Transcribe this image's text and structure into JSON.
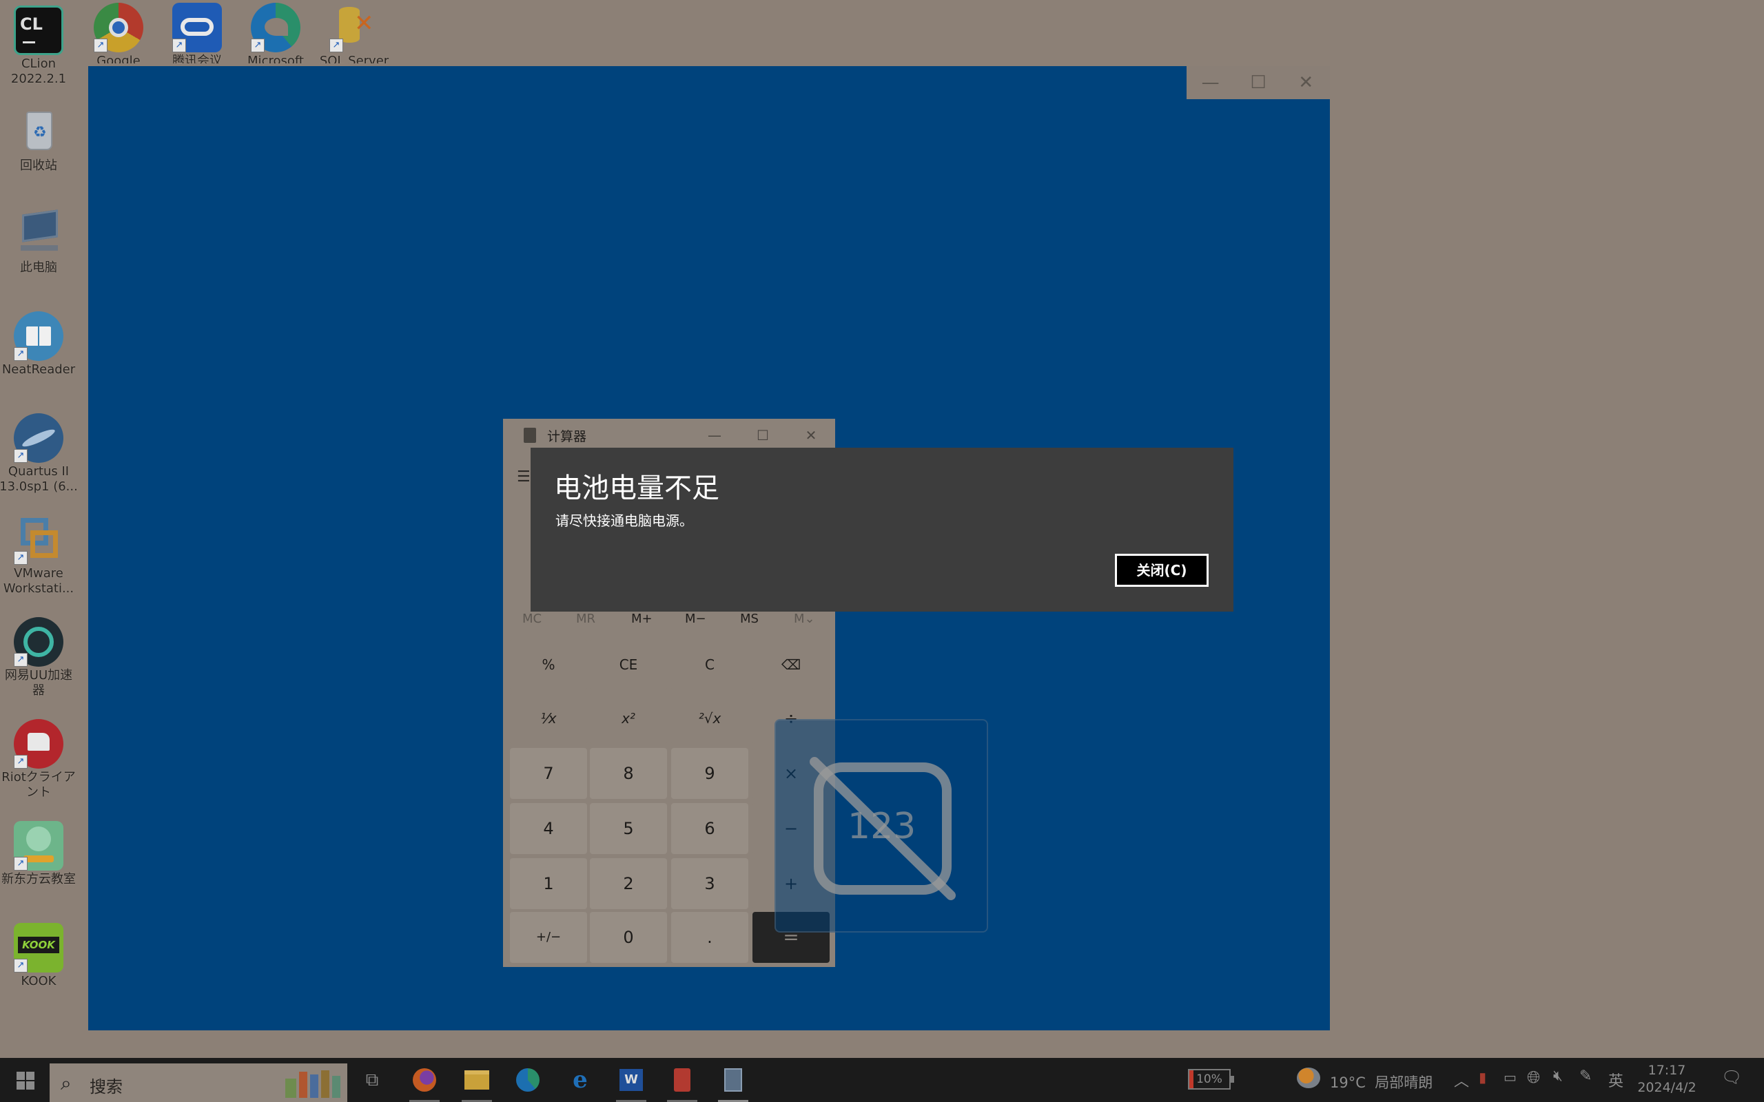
{
  "desktop": {
    "icons": [
      {
        "label": "CLion\n2022.2.1"
      },
      {
        "label": "Google"
      },
      {
        "label": "腾讯会议"
      },
      {
        "label": "Microsoft"
      },
      {
        "label": "SQL Server"
      },
      {
        "label": "回收站"
      },
      {
        "label": "此电脑"
      },
      {
        "label": "NeatReader"
      },
      {
        "label": "Quartus II\n13.0sp1 (6..."
      },
      {
        "label": "VMware\nWorkstati..."
      },
      {
        "label": "网易UU加速\n器"
      },
      {
        "label": "Riotクライア\nント"
      },
      {
        "label": "新东方云教室"
      },
      {
        "label": "KOOK"
      }
    ]
  },
  "background_window": {
    "minimize": "—",
    "maximize": "☐",
    "close": "✕"
  },
  "calculator": {
    "title": "计算器",
    "minimize": "—",
    "maximize": "☐",
    "close": "✕",
    "menu": "☰",
    "memory": [
      "MC",
      "MR",
      "M+",
      "M−",
      "MS",
      "M⌄"
    ],
    "keys": [
      [
        "%",
        "CE",
        "C",
        "⌫"
      ],
      [
        "¹⁄x",
        "x²",
        "²√x",
        "÷"
      ],
      [
        "7",
        "8",
        "9",
        "×"
      ],
      [
        "4",
        "5",
        "6",
        "−"
      ],
      [
        "1",
        "2",
        "3",
        "+"
      ],
      [
        "+/−",
        "0",
        ".",
        "="
      ]
    ]
  },
  "overlay_icon": "123",
  "dialog": {
    "title": "电池电量不足",
    "message": "请尽快接通电脑电源。",
    "close_button": "关闭(C)"
  },
  "taskbar": {
    "search_placeholder": "搜索",
    "battery_percent": "10%",
    "weather": "19°C  局部晴朗",
    "ime": "英",
    "time": "17:17",
    "date": "2024/4/2"
  },
  "colors": {
    "desktop": "#8c8076",
    "window_blue": "#00437c",
    "dialog_bg": "#3d3d3d",
    "taskbar": "#1b1b1b"
  }
}
